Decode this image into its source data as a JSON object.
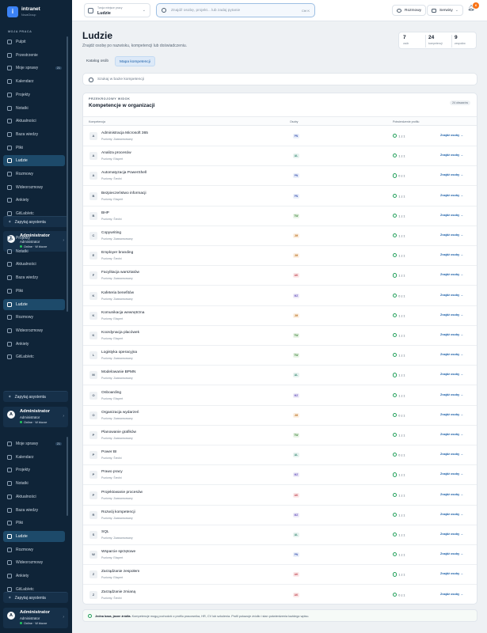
{
  "app": {
    "name": "intranet",
    "org": "NovaGroup",
    "logo_letter": "i"
  },
  "sidebar": {
    "section_label": "MOJA PRACA",
    "blocks": [
      {
        "items": [
          {
            "label": "Pulpit",
            "icon": "dashboard-icon"
          },
          {
            "label": "Przestrzenie",
            "icon": "spaces-icon"
          },
          {
            "label": "Moje sprawy",
            "icon": "tasks-icon",
            "count": "21"
          },
          {
            "label": "Kalendarz",
            "icon": "calendar-icon"
          },
          {
            "label": "Projekty",
            "icon": "folder-icon"
          },
          {
            "label": "Notatki",
            "icon": "notes-icon"
          },
          {
            "label": "Aktualności",
            "icon": "news-icon"
          },
          {
            "label": "Baza wiedzy",
            "icon": "book-icon"
          },
          {
            "label": "Pliki",
            "icon": "file-icon"
          },
          {
            "label": "Ludzie",
            "icon": "people-icon",
            "active": true
          },
          {
            "label": "Rozmowy",
            "icon": "chat-icon"
          },
          {
            "label": "Wideorozmowy",
            "icon": "video-icon"
          },
          {
            "label": "Ankiety",
            "icon": "poll-icon"
          },
          {
            "label": "GitLab/etc",
            "icon": "more-icon"
          }
        ]
      },
      {
        "items": [
          {
            "label": "Projekty",
            "icon": "folder-icon"
          },
          {
            "label": "Notatki",
            "icon": "notes-icon"
          },
          {
            "label": "Aktualności",
            "icon": "news-icon"
          },
          {
            "label": "Baza wiedzy",
            "icon": "book-icon"
          },
          {
            "label": "Pliki",
            "icon": "file-icon"
          },
          {
            "label": "Ludzie",
            "icon": "people-icon",
            "active": true
          },
          {
            "label": "Rozmowy",
            "icon": "chat-icon"
          },
          {
            "label": "Wideorozmowy",
            "icon": "video-icon"
          },
          {
            "label": "Ankiety",
            "icon": "poll-icon"
          },
          {
            "label": "GitLab/etc",
            "icon": "more-icon"
          }
        ]
      },
      {
        "items": [
          {
            "label": "Moje sprawy",
            "icon": "tasks-icon",
            "count": "21"
          },
          {
            "label": "Kalendarz",
            "icon": "calendar-icon"
          },
          {
            "label": "Projekty",
            "icon": "folder-icon"
          },
          {
            "label": "Notatki",
            "icon": "notes-icon"
          },
          {
            "label": "Aktualności",
            "icon": "news-icon"
          },
          {
            "label": "Baza wiedzy",
            "icon": "book-icon"
          },
          {
            "label": "Pliki",
            "icon": "file-icon"
          },
          {
            "label": "Ludzie",
            "icon": "people-icon",
            "active": true
          },
          {
            "label": "Rozmowy",
            "icon": "chat-icon"
          },
          {
            "label": "Wideorozmowy",
            "icon": "video-icon"
          },
          {
            "label": "Ankiety",
            "icon": "poll-icon"
          },
          {
            "label": "GitLab/etc",
            "icon": "more-icon"
          }
        ]
      }
    ],
    "assistant_label": "Zapytaj asystenta",
    "user": {
      "initial": "A",
      "name": "Administrator",
      "role": "Administrator",
      "status": "Online · W biurze"
    }
  },
  "topbar": {
    "workspace_label": "Twoja miejsce pracy",
    "workspace_value": "Ludzie",
    "search_placeholder": "Znajdź osobę, projekt... lub zadaj pytanie",
    "search_shortcut": "Ctrl K",
    "chats_label": "Rozmowy",
    "services_label": "Serwisy",
    "notifications_count": "6"
  },
  "page": {
    "title": "Ludzie",
    "subtitle": "Znajdź osobę po nazwisku, kompetencji lub doświadczeniu.",
    "stats": [
      {
        "value": "7",
        "label": "osób"
      },
      {
        "value": "24",
        "label": "kompetencji"
      },
      {
        "value": "9",
        "label": "zespołów"
      }
    ],
    "tabs": [
      {
        "label": "Katalog osób",
        "active": false
      },
      {
        "label": "Mapa kompetencji",
        "active": true
      }
    ],
    "kb_search_placeholder": "Szukaj w bazie kompetencji"
  },
  "panel": {
    "kicker": "PRZEKROJOWY WIDOK",
    "title": "Kompetencje w organizacji",
    "badge": "24 obszarów",
    "columns": {
      "competence": "Kompetencja",
      "people": "Osoby",
      "confirmed": "Potwierdzenie profilu"
    },
    "find_label": "Znajdź osoby →",
    "rows": [
      {
        "letter": "A",
        "name": "Administracja Microsoft 365",
        "level": "Poziomy: Zaawansowany",
        "person": "PN",
        "confirmed": "1 z 1"
      },
      {
        "letter": "A",
        "name": "Analiza procesów",
        "level": "Poziomy: Ekspert",
        "person": "AL",
        "confirmed": "1 z 1"
      },
      {
        "letter": "A",
        "name": "Automatyzacja PowerShell",
        "level": "Poziomy: Średni",
        "person": "PN",
        "confirmed": "0 z 1"
      },
      {
        "letter": "B",
        "name": "Bezpieczeństwo informacji",
        "level": "Poziomy: Ekspert",
        "person": "PN",
        "confirmed": "1 z 1"
      },
      {
        "letter": "B",
        "name": "BHP",
        "level": "Poziomy: Średni",
        "person": "TW",
        "confirmed": "1 z 1"
      },
      {
        "letter": "C",
        "name": "Copywriting",
        "level": "Poziomy: Zaawansowany",
        "person": "JM",
        "confirmed": "1 z 1"
      },
      {
        "letter": "E",
        "name": "Employer branding",
        "level": "Poziomy: Średni",
        "person": "JM",
        "confirmed": "1 z 1"
      },
      {
        "letter": "F",
        "name": "Facylitacja warsztatów",
        "level": "Poziomy: Zaawansowany",
        "person": "AK",
        "confirmed": "1 z 1"
      },
      {
        "letter": "K",
        "name": "Kafeteria benefitów",
        "level": "Poziomy: Zaawansowany",
        "person": "MZ",
        "confirmed": "0 z 1"
      },
      {
        "letter": "K",
        "name": "Komunikacja wewnętrzna",
        "level": "Poziomy: Ekspert",
        "person": "JM",
        "confirmed": "1 z 1"
      },
      {
        "letter": "K",
        "name": "Koordynacja placówek",
        "level": "Poziomy: Ekspert",
        "person": "TW",
        "confirmed": "1 z 1"
      },
      {
        "letter": "L",
        "name": "Logistyka operacyjna",
        "level": "Poziomy: Zaawansowany",
        "person": "TW",
        "confirmed": "1 z 1"
      },
      {
        "letter": "M",
        "name": "Modelowanie BPMN",
        "level": "Poziomy: Zaawansowany",
        "person": "AL",
        "confirmed": "1 z 1"
      },
      {
        "letter": "O",
        "name": "Onboarding",
        "level": "Poziomy: Ekspert",
        "person": "MZ",
        "confirmed": "1 z 1"
      },
      {
        "letter": "O",
        "name": "Organizacja wydarzeń",
        "level": "Poziomy: Zaawansowany",
        "person": "JM",
        "confirmed": "0 z 1"
      },
      {
        "letter": "P",
        "name": "Planowanie grafików",
        "level": "Poziomy: Zaawansowany",
        "person": "TW",
        "confirmed": "1 z 1"
      },
      {
        "letter": "P",
        "name": "Power BI",
        "level": "Poziomy: Średni",
        "person": "AL",
        "confirmed": "0 z 1"
      },
      {
        "letter": "P",
        "name": "Prawo pracy",
        "level": "Poziomy: Średni",
        "person": "MZ",
        "confirmed": "1 z 1"
      },
      {
        "letter": "P",
        "name": "Projektowanie procesów",
        "level": "Poziomy: Zaawansowany",
        "person": "AK",
        "confirmed": "1 z 1"
      },
      {
        "letter": "R",
        "name": "Rozwój kompetencji",
        "level": "Poziomy: Zaawansowany",
        "person": "MZ",
        "confirmed": "1 z 1"
      },
      {
        "letter": "S",
        "name": "SQL",
        "level": "Poziomy: Zaawansowany",
        "person": "AL",
        "confirmed": "1 z 1"
      },
      {
        "letter": "W",
        "name": "Wsparcie sprzętowe",
        "level": "Poziomy: Ekspert",
        "person": "PN",
        "confirmed": "1 z 1"
      },
      {
        "letter": "Z",
        "name": "Zarządzanie zespołem",
        "level": "Poziomy: Ekspert",
        "person": "AK",
        "confirmed": "1 z 1"
      },
      {
        "letter": "Z",
        "name": "Zarządzanie zmianą",
        "level": "Poziomy: Średni",
        "person": "AK",
        "confirmed": "0 z 1"
      }
    ]
  },
  "person_colors": {
    "PN": {
      "bg": "#e9eef9",
      "fg": "#4b63b8"
    },
    "AL": {
      "bg": "#e7f2ef",
      "fg": "#3a8a74"
    },
    "TW": {
      "bg": "#e8f3e7",
      "fg": "#4a8d45"
    },
    "JM": {
      "bg": "#fbf0e4",
      "fg": "#c07a2c"
    },
    "AK": {
      "bg": "#fbe9ea",
      "fg": "#c24b55"
    },
    "MZ": {
      "bg": "#eeebf8",
      "fg": "#6d5bbf"
    }
  },
  "footer": {
    "bold": "Jedna baza, jasne źródła.",
    "text": " Kompetencje mogą pochodzić z profilu pracownika, HR, CV lub szkolenia. Profil pokazuje źródło i stan potwierdzenia każdego wpisu."
  }
}
